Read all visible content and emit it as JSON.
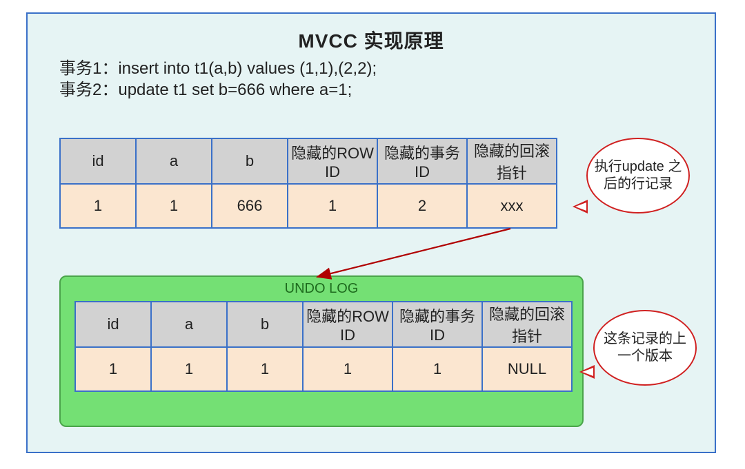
{
  "title": "MVCC 实现原理",
  "tx1": "事务1：insert into t1(a,b) values (1,1),(2,2);",
  "tx2": "事务2：update t1 set b=666 where a=1;",
  "headers": {
    "id": "id",
    "a": "a",
    "b": "b",
    "rowid": "隐藏的ROW ID",
    "trxid": "隐藏的事务ID",
    "rollptr": "隐藏的回滚指针"
  },
  "upper_row": {
    "id": "1",
    "a": "1",
    "b": "666",
    "rowid": "1",
    "trxid": "2",
    "rollptr": "xxx"
  },
  "undo_label": "UNDO LOG",
  "lower_row": {
    "id": "1",
    "a": "1",
    "b": "1",
    "rowid": "1",
    "trxid": "1",
    "rollptr": "NULL"
  },
  "callout1": "执行update 之后的行记录",
  "callout2": "这条记录的上一个版本",
  "chart_data": {
    "type": "table",
    "tables": [
      {
        "name": "after_update_row",
        "columns": [
          "id",
          "a",
          "b",
          "隐藏的ROW ID",
          "隐藏的事务ID",
          "隐藏的回滚指针"
        ],
        "rows": [
          [
            "1",
            "1",
            "666",
            "1",
            "2",
            "xxx"
          ]
        ]
      },
      {
        "name": "undo_log_row",
        "columns": [
          "id",
          "a",
          "b",
          "隐藏的ROW ID",
          "隐藏的事务ID",
          "隐藏的回滚指针"
        ],
        "rows": [
          [
            "1",
            "1",
            "1",
            "1",
            "1",
            "NULL"
          ]
        ]
      }
    ],
    "relationship": "after_update_row.隐藏的回滚指针 -> undo_log_row (previous version)",
    "annotations": {
      "callout1": "执行update 之后的行记录",
      "callout2": "这条记录的上一个版本"
    }
  }
}
